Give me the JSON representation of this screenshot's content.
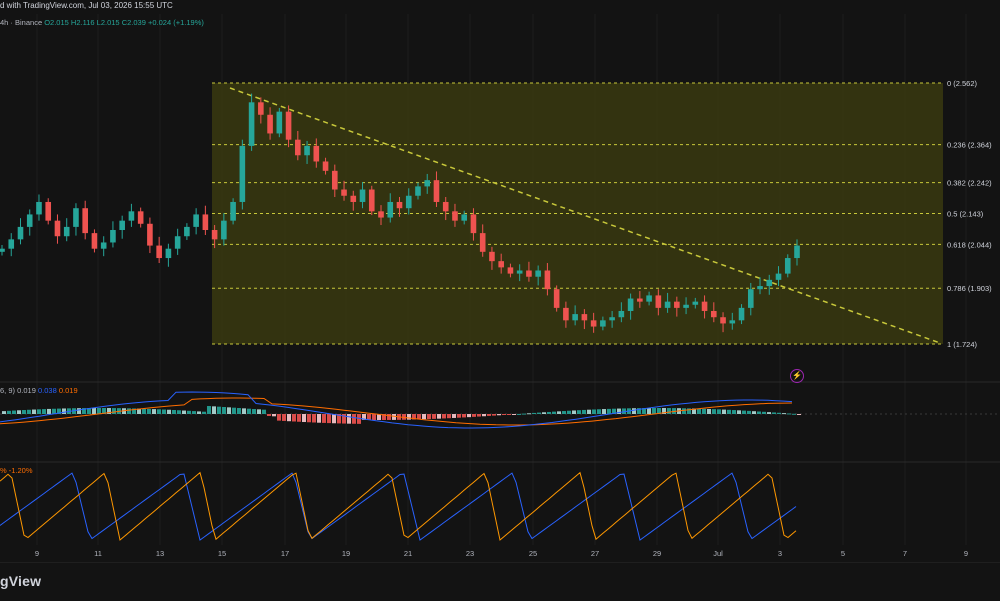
{
  "header": {
    "published": "d with TradingView.com, Jul 03, 2026 15:55 UTC"
  },
  "symbol_bar": {
    "timeframe": "4h",
    "exchange": "Binance",
    "open": "O2.015",
    "high": "H2.116",
    "low": "L2.015",
    "close": "C2.039",
    "change": "+0.024 (+1.19%)"
  },
  "macd": {
    "params": "6, 9)",
    "hist": "0.019",
    "macd": "0.038",
    "signal": "0.019"
  },
  "stoch": {
    "label": "% -1.20%"
  },
  "fib_levels": [
    {
      "label": "0 (2.562)",
      "value": 2.562
    },
    {
      "label": "0.236 (2.364)",
      "value": 2.364
    },
    {
      "label": "0.382 (2.242)",
      "value": 2.242
    },
    {
      "label": "0.5 (2.143)",
      "value": 2.143
    },
    {
      "label": "0.618 (2.044)",
      "value": 2.044
    },
    {
      "label": "0.786 (1.903)",
      "value": 1.903
    },
    {
      "label": "1 (1.724)",
      "value": 1.724
    }
  ],
  "x_axis": [
    "9",
    "11",
    "13",
    "15",
    "17",
    "19",
    "21",
    "23",
    "25",
    "27",
    "29",
    "Jul",
    "3",
    "5",
    "7",
    "9"
  ],
  "footer": {
    "logo": "gView"
  },
  "colors": {
    "up": "#26a69a",
    "down": "#ef5350",
    "fib_line": "#c8c83a",
    "fib_fill": "#3a3a10",
    "macd": "#2962ff",
    "signal": "#ff6d00"
  },
  "chart_data": {
    "type": "candlestick",
    "exchange": "Binance",
    "timeframe": "4h",
    "fib_retracement": {
      "start": 2.562,
      "end": 1.724
    },
    "approx_closes": [
      2.03,
      2.06,
      2.1,
      2.14,
      2.18,
      2.12,
      2.07,
      2.1,
      2.16,
      2.08,
      2.03,
      2.05,
      2.09,
      2.12,
      2.15,
      2.11,
      2.04,
      2.0,
      2.03,
      2.07,
      2.1,
      2.14,
      2.09,
      2.06,
      2.12,
      2.18,
      2.36,
      2.5,
      2.46,
      2.4,
      2.47,
      2.38,
      2.33,
      2.36,
      2.31,
      2.28,
      2.22,
      2.2,
      2.18,
      2.22,
      2.15,
      2.13,
      2.18,
      2.16,
      2.2,
      2.23,
      2.25,
      2.18,
      2.15,
      2.12,
      2.14,
      2.08,
      2.02,
      1.99,
      1.97,
      1.95,
      1.96,
      1.94,
      1.96,
      1.9,
      1.84,
      1.8,
      1.82,
      1.8,
      1.78,
      1.8,
      1.81,
      1.83,
      1.87,
      1.86,
      1.88,
      1.84,
      1.86,
      1.84,
      1.85,
      1.86,
      1.83,
      1.81,
      1.79,
      1.8,
      1.84,
      1.9,
      1.91,
      1.93,
      1.95,
      2.0,
      2.04
    ],
    "macd_hist_values": [
      0.019
    ],
    "macd_value": 0.038,
    "signal_value": 0.019
  }
}
